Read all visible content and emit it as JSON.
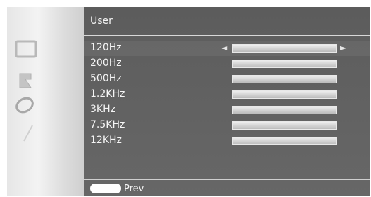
{
  "menu": {
    "title": "User",
    "bands": [
      {
        "label": "120Hz",
        "level": 1.0,
        "selected": true
      },
      {
        "label": "200Hz",
        "level": 1.0,
        "selected": false
      },
      {
        "label": "500Hz",
        "level": 1.0,
        "selected": false
      },
      {
        "label": "1.2KHz",
        "level": 1.0,
        "selected": false
      },
      {
        "label": "3KHz",
        "level": 1.0,
        "selected": false
      },
      {
        "label": "7.5KHz",
        "level": 1.0,
        "selected": false
      },
      {
        "label": "12KHz",
        "level": 1.0,
        "selected": false
      }
    ],
    "left_arrow": "◄",
    "right_arrow": "►"
  },
  "footer": {
    "prev_label": "Prev"
  },
  "sidebar": {
    "icons": [
      "picture-icon",
      "sound-icon",
      "setup-icon",
      "edit-icon"
    ]
  },
  "colors": {
    "panel": "#676767",
    "text": "#f2f2f2",
    "slider": "#c9c9c9"
  }
}
